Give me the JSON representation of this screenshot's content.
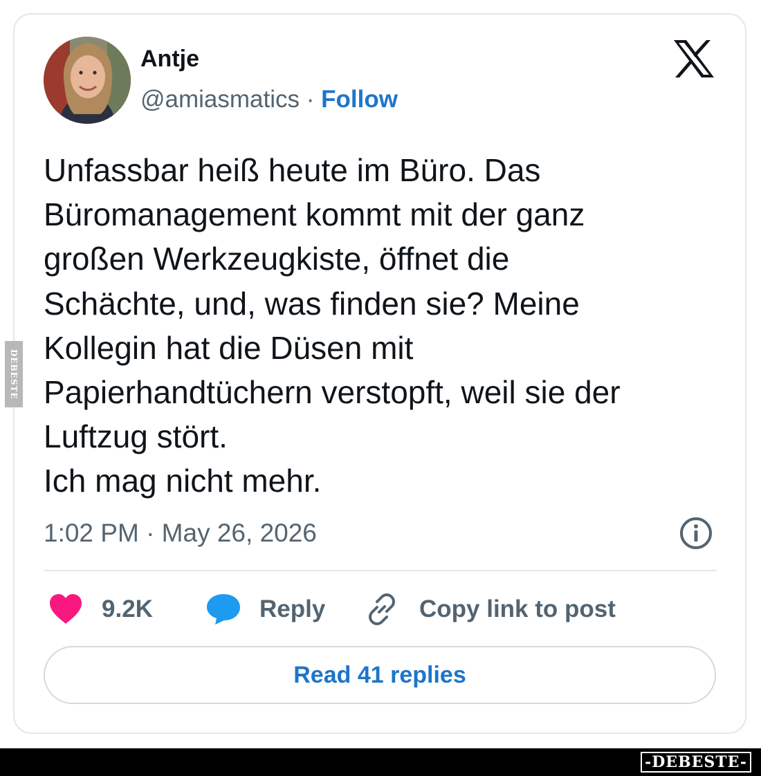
{
  "author": {
    "display_name": "Antje",
    "handle": "@amiasmatics",
    "separator": "·",
    "follow_label": "Follow"
  },
  "tweet": {
    "text": "Unfassbar heiß heute im Büro. Das\nBüromanagement kommt mit der ganz\ngroßen Werkzeugkiste, öffnet die\nSchächte, und, was finden sie? Meine\nKollegin hat die Düsen mit\nPapierhandtüchern verstopft, weil sie der\nLuftzug stört.\nIch mag nicht mehr.",
    "timestamp": "1:02 PM · May 26, 2026"
  },
  "actions": {
    "like_count": "9.2K",
    "reply_label": "Reply",
    "copy_link_label": "Copy link to post"
  },
  "read_replies_label": "Read 41 replies",
  "watermarks": {
    "side": "DEBESTE",
    "footer": "-DEBESTE-"
  },
  "colors": {
    "accent_blue": "#1d75c9",
    "heart_pink": "#f91880",
    "reply_bubble_blue": "#1d9bf0",
    "muted_gray": "#536471"
  },
  "icons": {
    "platform_logo": "x-logo-icon",
    "info": "info-icon",
    "like": "heart-icon",
    "reply": "speech-bubble-icon",
    "copy_link": "link-icon"
  }
}
